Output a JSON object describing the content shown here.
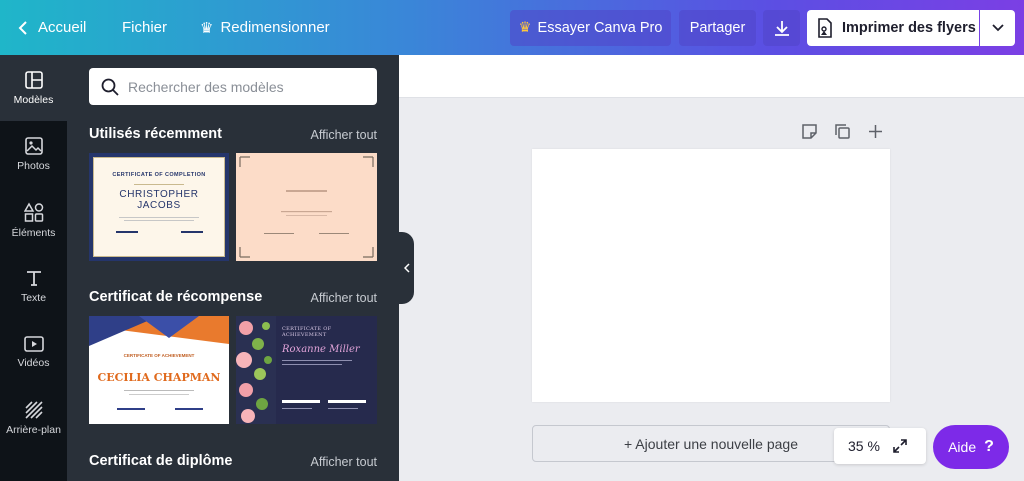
{
  "topbar": {
    "back_label": "Accueil",
    "file_label": "Fichier",
    "resize_label": "Redimensionner",
    "pro_label": "Essayer Canva Pro",
    "share_label": "Partager",
    "print_label": "Imprimer des flyers"
  },
  "rail": {
    "items": [
      {
        "label": "Modèles"
      },
      {
        "label": "Photos"
      },
      {
        "label": "Éléments"
      },
      {
        "label": "Texte"
      },
      {
        "label": "Vidéos"
      },
      {
        "label": "Arrière-plan"
      }
    ]
  },
  "panel": {
    "search_placeholder": "Rechercher des modèles",
    "sections": [
      {
        "title": "Utilisés récemment",
        "more": "Afficher tout"
      },
      {
        "title": "Certificat de récompense",
        "more": "Afficher tout"
      },
      {
        "title": "Certificat de diplôme",
        "more": "Afficher tout"
      }
    ],
    "thumbs": {
      "t1": {
        "heading": "CERTIFICATE OF COMPLETION",
        "name1": "CHRISTOPHER",
        "name2": "JACOBS"
      },
      "t3": {
        "heading": "CERTIFICATE OF ACHIEVEMENT",
        "name": "CECILIA CHAPMAN"
      },
      "t4": {
        "heading": "CERTIFICATE OF ACHIEVEMENT",
        "name": "Roxanne Miller"
      }
    }
  },
  "canvas": {
    "add_page_label": "+ Ajouter une nouvelle page",
    "zoom": "35 %",
    "help_label": "Aide",
    "help_symbol": "?"
  },
  "colors": {
    "accent": "#7d2ae8",
    "panel": "#293039",
    "rail": "#0e1318"
  }
}
